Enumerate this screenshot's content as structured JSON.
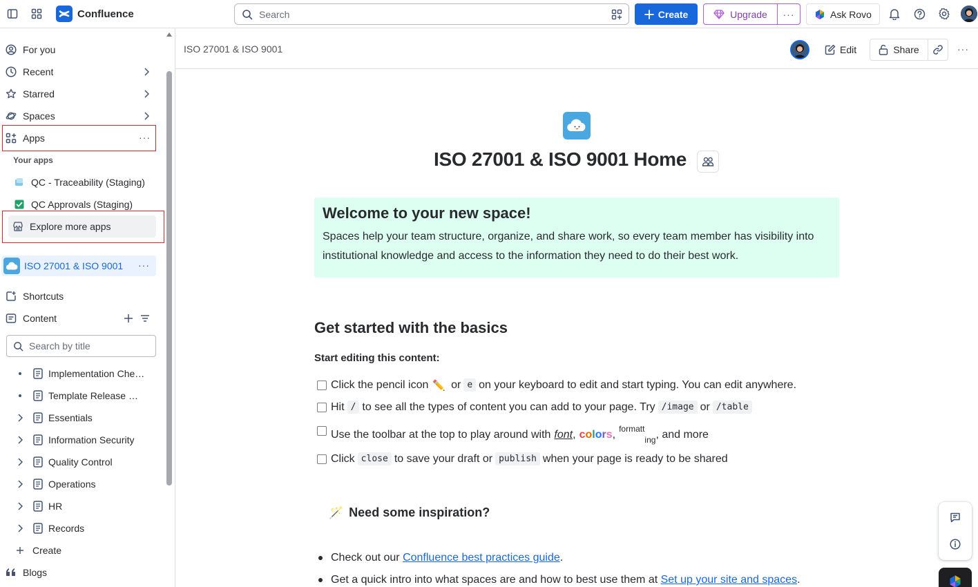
{
  "topbar": {
    "app_name": "Confluence",
    "search_placeholder": "Search",
    "create_label": "Create",
    "upgrade_label": "Upgrade",
    "upgrade_more": "···",
    "rovo_label": "Ask Rovo",
    "accent_color": "#1868DB"
  },
  "sidebar": {
    "nav": [
      {
        "label": "For you",
        "icon": "user-circle-icon"
      },
      {
        "label": "Recent",
        "icon": "clock-icon"
      },
      {
        "label": "Starred",
        "icon": "star-icon"
      },
      {
        "label": "Spaces",
        "icon": "planet-icon"
      },
      {
        "label": "Apps",
        "icon": "apps-grid-icon"
      }
    ],
    "more": "···",
    "your_apps_label": "Your apps",
    "apps": [
      {
        "label": "QC - Traceability (Staging)"
      },
      {
        "label": "QC Approvals (Staging)"
      },
      {
        "label": "Explore more apps"
      }
    ],
    "space_name": "ISO 27001 & ISO 9001",
    "shortcuts_label": "Shortcuts",
    "content_label": "Content",
    "tree_search_placeholder": "Search by title",
    "tree": [
      {
        "label": "Implementation Checklist",
        "expander": "bullet"
      },
      {
        "label": "Template Release Notes",
        "expander": "bullet"
      },
      {
        "label": "Essentials",
        "expander": "chevron"
      },
      {
        "label": "Information Security",
        "expander": "chevron"
      },
      {
        "label": "Quality Control",
        "expander": "chevron"
      },
      {
        "label": "Operations",
        "expander": "chevron"
      },
      {
        "label": "HR",
        "expander": "chevron"
      },
      {
        "label": "Records",
        "expander": "chevron"
      }
    ],
    "create_label": "Create",
    "blogs_label": "Blogs"
  },
  "page_header": {
    "breadcrumb": "ISO 27001 & ISO 9001",
    "edit_label": "Edit",
    "share_label": "Share",
    "more": "···"
  },
  "content": {
    "title": "ISO 27001 & ISO 9001 Home",
    "panel": {
      "heading": "Welcome to your new space!",
      "body": "Spaces help your team structure, organize, and share work, so every team member has visibility into institutional knowledge and access to the information they need to do their best work."
    },
    "basics_heading": "Get started with the basics",
    "start_editing": "Start editing this content:",
    "tasks": {
      "t1_a": "Click the pencil icon",
      "t1_emoji": "✏️",
      "t1_b": "or",
      "t1_code": "e",
      "t1_c": "on your keyboard to edit and start typing. You can edit anywhere.",
      "t2_a": "Hit",
      "t2_code1": "/",
      "t2_b": "to see all the types of content you can add to your page. Try",
      "t2_code2": "/image",
      "t2_c": "or",
      "t2_code3": "/table",
      "t3_a": "Use the toolbar at the top to play around with",
      "t3_font": "font",
      "t3_comma": ",",
      "t3_colors": [
        "c",
        "o",
        "l",
        "o",
        "r",
        "s"
      ],
      "t3_colors_palette": [
        "#E2483D",
        "#E06C00",
        "#22A06B",
        "#1D7AFC",
        "#6E5DC6",
        "#E774BB"
      ],
      "t3_sup": "formatt",
      "t3_sub": "ing",
      "t3_end": ", and more",
      "t4_a": "Click",
      "t4_code1": "close",
      "t4_b": "to save your draft or",
      "t4_code2": "publish",
      "t4_c": "when your page is ready to be shared"
    },
    "inspiration_emoji": "🪄",
    "inspiration_heading": "Need some inspiration?",
    "bullets": [
      {
        "pre": "Check out our ",
        "link": "Confluence best practices guide",
        "post": "."
      },
      {
        "pre": "Get a quick intro into what spaces are and how to best use them at ",
        "link": "Set up your site and spaces",
        "post": "."
      }
    ]
  }
}
